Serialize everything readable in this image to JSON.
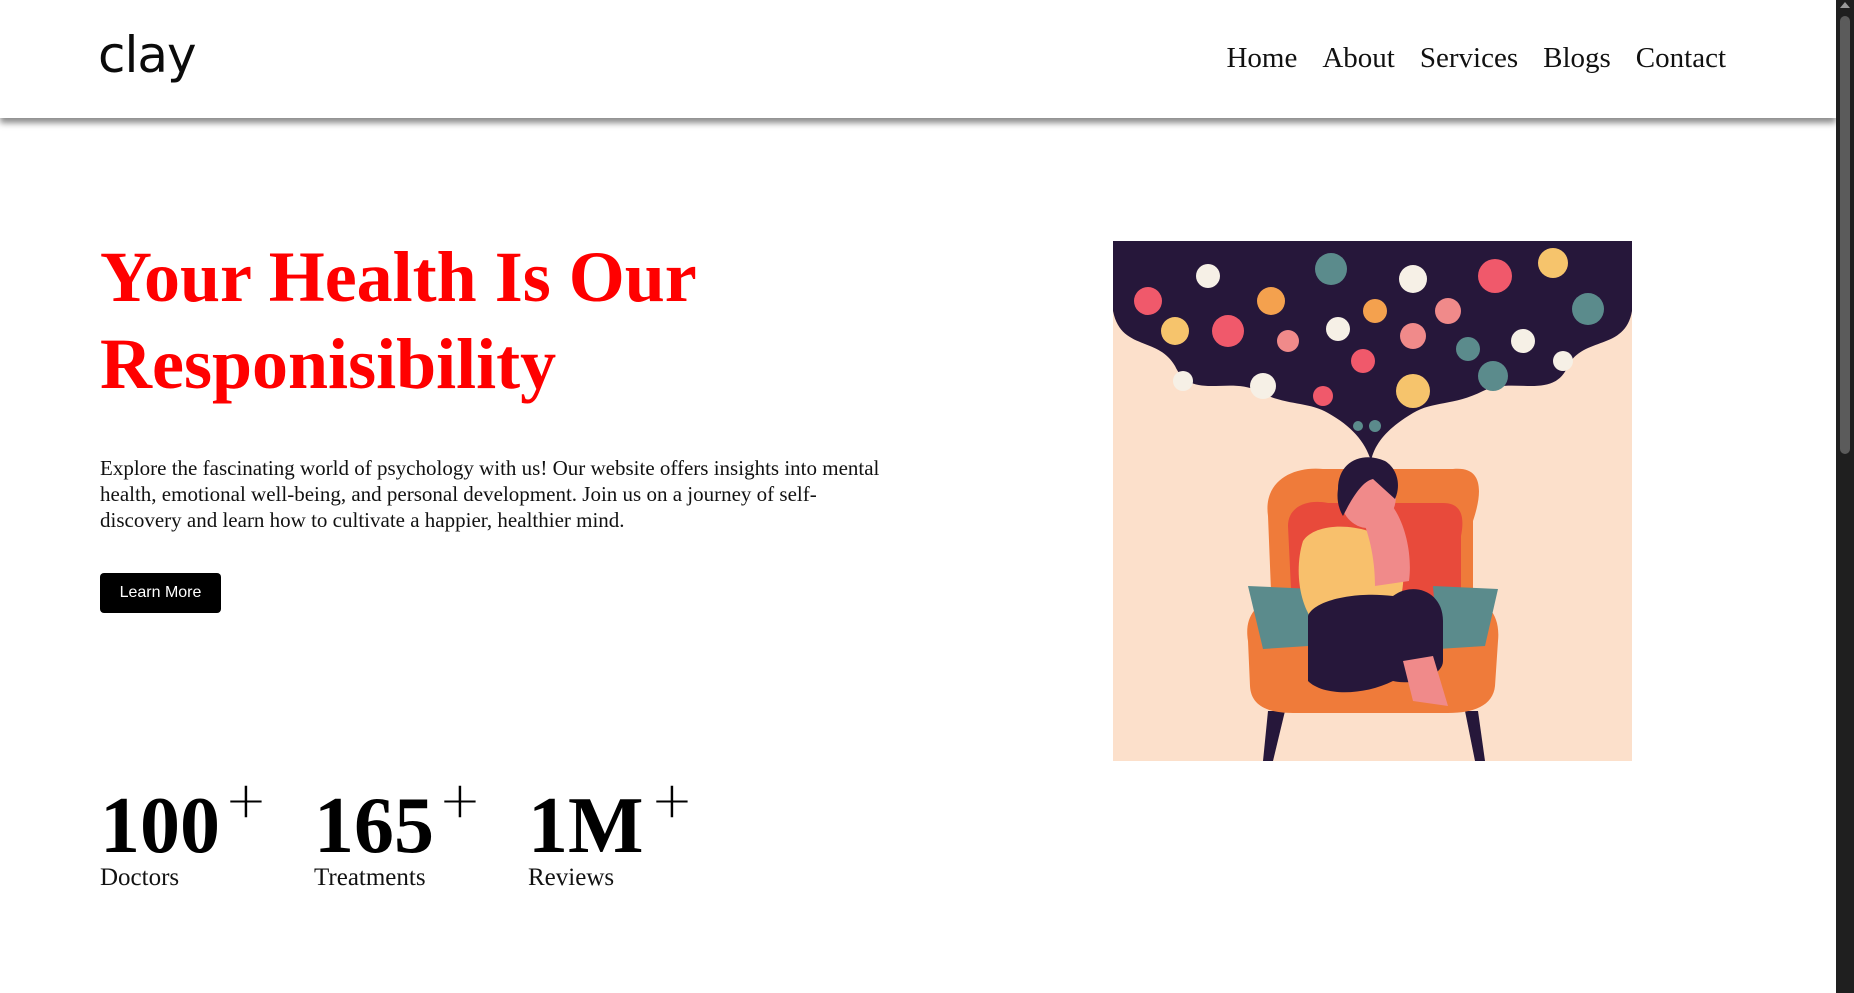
{
  "header": {
    "logo": "clay",
    "nav": [
      "Home",
      "About",
      "Services",
      "Blogs",
      "Contact"
    ]
  },
  "hero": {
    "title_line1": "Your Health Is Our",
    "title_line2": "Responisibility",
    "description": "Explore the fascinating world of psychology with us! Our website offers insights into mental health, emotional well-being, and personal development. Join us on a journey of self-discovery and learn how to cultivate a happier, healthier mind.",
    "button_label": "Learn More"
  },
  "stats": [
    {
      "value": "100",
      "plus": "+",
      "label": "Doctors"
    },
    {
      "value": "165",
      "plus": "+",
      "label": "Treatments"
    },
    {
      "value": "1M",
      "plus": "+",
      "label": "Reviews"
    }
  ],
  "illustration": {
    "icon": "anxious-woman-in-armchair-illustration",
    "background": "#fce0cb",
    "cloud_color": "#26173a",
    "chair_color": "#ef7b3a"
  },
  "colors": {
    "title": "#ff0000",
    "button_bg": "#000000",
    "button_text": "#ffffff"
  }
}
